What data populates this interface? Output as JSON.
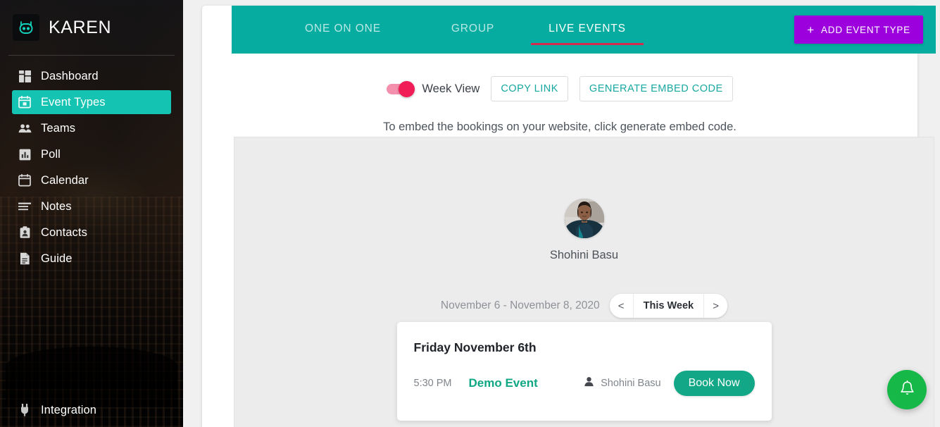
{
  "sidebar": {
    "brand": {
      "name": "KAREN",
      "logo_icon": "robot-head-icon"
    },
    "items": [
      {
        "label": "Dashboard",
        "icon": "dashboard-grid-icon",
        "active": false
      },
      {
        "label": "Event Types",
        "icon": "calendar-today-icon",
        "active": true
      },
      {
        "label": "Teams",
        "icon": "people-icon",
        "active": false
      },
      {
        "label": "Poll",
        "icon": "bar-chart-icon",
        "active": false
      },
      {
        "label": "Calendar",
        "icon": "calendar-icon",
        "active": false
      },
      {
        "label": "Notes",
        "icon": "notes-lines-icon",
        "active": false
      },
      {
        "label": "Contacts",
        "icon": "contacts-card-icon",
        "active": false
      },
      {
        "label": "Guide",
        "icon": "document-icon",
        "active": false
      }
    ],
    "bottom_item": {
      "label": "Integration",
      "icon": "plug-icon"
    },
    "active_color": "#15c3b2"
  },
  "tabs": [
    {
      "label": "ONE ON ONE",
      "active": false
    },
    {
      "label": "GROUP",
      "active": false
    },
    {
      "label": "LIVE EVENTS",
      "active": true
    }
  ],
  "header": {
    "background_color": "#06aca0",
    "active_tab_underline_color": "#d32a4e",
    "add_event_button": {
      "label": "ADD EVENT TYPE",
      "icon": "plus-icon",
      "color": "#9b00dd"
    }
  },
  "toolbar": {
    "week_view_toggle": {
      "label": "Week View",
      "enabled": true,
      "knob_color": "#f01d56",
      "track_color": "#f490ad"
    },
    "copy_link_label": "COPY LINK",
    "generate_embed_label": "GENERATE EMBED CODE",
    "button_text_color": "#17a8a0"
  },
  "embed_hint": "To embed the bookings on your website, click generate embed code.",
  "preview": {
    "background_color": "#ececec",
    "host": {
      "name": "Shohini Basu",
      "avatar_icon": "user-avatar-photo"
    },
    "date_range": "November 6 - November 8, 2020",
    "week_nav": {
      "prev_label": "<",
      "current_label": "This Week",
      "next_label": ">"
    },
    "event": {
      "day": "Friday November 6th",
      "time": "5:30 PM",
      "title": "Demo Event",
      "host_icon": "person-icon",
      "host_name": "Shohini Basu",
      "book_button_label": "Book Now",
      "title_color": "#10a884",
      "book_button_color": "#12a786"
    }
  },
  "fab": {
    "icon": "bell-icon",
    "color": "#16b848"
  }
}
